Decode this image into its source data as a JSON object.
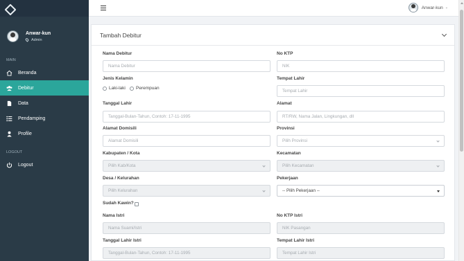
{
  "sidebar": {
    "user": {
      "name": "Anwar-kun",
      "role": "Admin"
    },
    "main_label": "MAIN",
    "items": [
      {
        "label": "Beranda",
        "icon": "home-icon"
      },
      {
        "label": "Debitur",
        "icon": "users-icon",
        "active": true
      },
      {
        "label": "Data",
        "icon": "file-icon"
      },
      {
        "label": "Pendamping",
        "icon": "list-icon"
      },
      {
        "label": "Profile",
        "icon": "user-icon"
      }
    ],
    "logout_label": "LOGOUT",
    "logout_item": {
      "label": "Logout",
      "icon": "power-icon"
    }
  },
  "topbar": {
    "user_name": "Anwar-kun",
    "caret": "⌄"
  },
  "form": {
    "title": "Tambah Debitur",
    "nama_debitur": {
      "label": "Nama Debitur",
      "placeholder": "Nama Debitur"
    },
    "no_ktp": {
      "label": "No KTP",
      "placeholder": "NIK"
    },
    "jenis_kelamin": {
      "label": "Jenis Kelamin",
      "options": [
        "Laki-laki",
        "Perempuan"
      ]
    },
    "tempat_lahir": {
      "label": "Tempat Lahir",
      "placeholder": "Tempat Lahir"
    },
    "tanggal_lahir": {
      "label": "Tanggal Lahir",
      "placeholder": "Tanggal-Bulan-Tahun, Contoh: 17-11-1995"
    },
    "alamat": {
      "label": "Alamat",
      "placeholder": "RT/RW, Nama Jalan, Lingkungan, dll"
    },
    "alamat_domisili": {
      "label": "Alamat Domisili",
      "placeholder": "Alamat Domisili"
    },
    "provinsi": {
      "label": "Provinsi",
      "placeholder": "Pilih Provinsi"
    },
    "kabupaten": {
      "label": "Kabupaten / Kota",
      "placeholder": "Pilih Kab/Kota"
    },
    "kecamatan": {
      "label": "Kecamatan",
      "placeholder": "Pilih Kecamatan"
    },
    "desa": {
      "label": "Desa / Kelurahan",
      "placeholder": "Pilih Kelurahan"
    },
    "pekerjaan": {
      "label": "Pekerjaan",
      "value": "-- Pilih Pekerjaan --"
    },
    "sudah_kawin": {
      "label": "Sudah Kawin?"
    },
    "nama_istri": {
      "label": "Nama Istri",
      "placeholder": "Nama Suami/Istri"
    },
    "no_ktp_istri": {
      "label": "No KTP Istri",
      "placeholder": "NIK Pasangan"
    },
    "tanggal_lahir_istri": {
      "label": "Tanggal Lahir Istri",
      "placeholder": "Tanggal-Bulan-Tahun, Contoh: 17-11-1995"
    },
    "tempat_lahir_istri": {
      "label": "Tempat Lahir Istri",
      "placeholder": "Tempat Lahir Istri"
    }
  },
  "colors": {
    "sidebar_bg": "#2a3b47",
    "accent": "#2ba69b",
    "page_bg": "#f1f3f6"
  }
}
